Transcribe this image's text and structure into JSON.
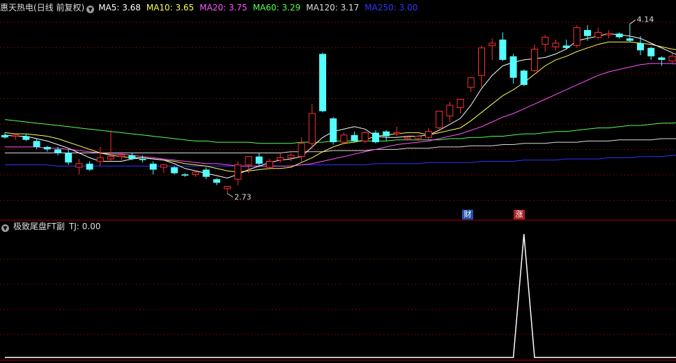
{
  "title": "惠天热电",
  "period": "(日线 前复权)",
  "ma_labels": [
    {
      "label": "MA5: 3.68",
      "color": "#ffffff"
    },
    {
      "label": "MA10: 3.65",
      "color": "#ffff55"
    },
    {
      "label": "MA20: 3.75",
      "color": "#ff55ff"
    },
    {
      "label": "MA60: 3.29",
      "color": "#55ff55"
    },
    {
      "label": "MA120: 3.17",
      "color": "#dddddd"
    },
    {
      "label": "MA250: 3.00",
      "color": "#3333ff"
    }
  ],
  "indicator": {
    "name": "极致尾盘FT副",
    "value_label": "TJ: 0.00"
  },
  "annotations": {
    "high": "4.14",
    "low": "2.73"
  },
  "badges": [
    {
      "text": "财",
      "color": "#2255aa"
    },
    {
      "text": "涨",
      "color": "#aa2222"
    }
  ],
  "colors": {
    "up": "#ff3030",
    "down": "#54ffff",
    "grid": "#7a0000",
    "divider": "#b00000"
  },
  "chart_data": {
    "type": "candlestick",
    "price_range": [
      2.6,
      4.2
    ],
    "candles": [
      {
        "o": 3.22,
        "h": 3.24,
        "l": 3.19,
        "c": 3.2
      },
      {
        "o": 3.21,
        "h": 3.23,
        "l": 3.18,
        "c": 3.22
      },
      {
        "o": 3.21,
        "h": 3.23,
        "l": 3.17,
        "c": 3.18
      },
      {
        "o": 3.17,
        "h": 3.19,
        "l": 3.1,
        "c": 3.12
      },
      {
        "o": 3.12,
        "h": 3.13,
        "l": 3.08,
        "c": 3.1
      },
      {
        "o": 3.1,
        "h": 3.12,
        "l": 3.05,
        "c": 3.07
      },
      {
        "o": 3.07,
        "h": 3.1,
        "l": 2.97,
        "c": 2.99
      },
      {
        "o": 2.95,
        "h": 3.02,
        "l": 2.89,
        "c": 2.98
      },
      {
        "o": 2.98,
        "h": 3.0,
        "l": 2.92,
        "c": 2.93
      },
      {
        "o": 3.0,
        "h": 3.12,
        "l": 2.96,
        "c": 3.03
      },
      {
        "o": 3.02,
        "h": 3.26,
        "l": 3.0,
        "c": 3.04
      },
      {
        "o": 3.04,
        "h": 3.08,
        "l": 3.01,
        "c": 3.05
      },
      {
        "o": 3.05,
        "h": 3.07,
        "l": 3.01,
        "c": 3.02
      },
      {
        "o": 3.02,
        "h": 3.05,
        "l": 2.99,
        "c": 3.01
      },
      {
        "o": 2.98,
        "h": 3.0,
        "l": 2.89,
        "c": 2.93
      },
      {
        "o": 2.95,
        "h": 2.98,
        "l": 2.9,
        "c": 2.97
      },
      {
        "o": 2.95,
        "h": 2.96,
        "l": 2.89,
        "c": 2.9
      },
      {
        "o": 2.89,
        "h": 2.9,
        "l": 2.87,
        "c": 2.88
      },
      {
        "o": 2.89,
        "h": 2.92,
        "l": 2.87,
        "c": 2.91
      },
      {
        "o": 2.93,
        "h": 2.95,
        "l": 2.85,
        "c": 2.87
      },
      {
        "o": 2.85,
        "h": 2.86,
        "l": 2.8,
        "c": 2.82
      },
      {
        "o": 2.77,
        "h": 2.79,
        "l": 2.73,
        "c": 2.79
      },
      {
        "o": 2.85,
        "h": 3.0,
        "l": 2.8,
        "c": 2.97
      },
      {
        "o": 2.97,
        "h": 3.0,
        "l": 2.9,
        "c": 3.04
      },
      {
        "o": 3.04,
        "h": 3.07,
        "l": 2.95,
        "c": 2.98
      },
      {
        "o": 2.95,
        "h": 3.02,
        "l": 2.93,
        "c": 3.0
      },
      {
        "o": 3.01,
        "h": 3.07,
        "l": 2.99,
        "c": 3.03
      },
      {
        "o": 3.03,
        "h": 3.07,
        "l": 3.0,
        "c": 3.05
      },
      {
        "o": 3.04,
        "h": 3.2,
        "l": 3.0,
        "c": 3.15
      },
      {
        "o": 3.15,
        "h": 3.48,
        "l": 3.1,
        "c": 3.4
      },
      {
        "o": 3.9,
        "h": 3.91,
        "l": 3.41,
        "c": 3.42
      },
      {
        "o": 3.36,
        "h": 3.37,
        "l": 3.14,
        "c": 3.16
      },
      {
        "o": 3.16,
        "h": 3.24,
        "l": 3.14,
        "c": 3.22
      },
      {
        "o": 3.22,
        "h": 3.25,
        "l": 3.16,
        "c": 3.17
      },
      {
        "o": 3.17,
        "h": 3.25,
        "l": 3.15,
        "c": 3.24
      },
      {
        "o": 3.24,
        "h": 3.26,
        "l": 3.15,
        "c": 3.16
      },
      {
        "o": 3.25,
        "h": 3.26,
        "l": 3.17,
        "c": 3.21
      },
      {
        "o": 3.23,
        "h": 3.29,
        "l": 3.21,
        "c": 3.24
      },
      {
        "o": 3.19,
        "h": 3.21,
        "l": 3.18,
        "c": 3.2
      },
      {
        "o": 3.19,
        "h": 3.22,
        "l": 3.17,
        "c": 3.21
      },
      {
        "o": 3.2,
        "h": 3.28,
        "l": 3.18,
        "c": 3.25
      },
      {
        "o": 3.28,
        "h": 3.42,
        "l": 3.26,
        "c": 3.42
      },
      {
        "o": 3.38,
        "h": 3.5,
        "l": 3.33,
        "c": 3.47
      },
      {
        "o": 3.45,
        "h": 3.52,
        "l": 3.4,
        "c": 3.52
      },
      {
        "o": 3.62,
        "h": 3.7,
        "l": 3.58,
        "c": 3.7
      },
      {
        "o": 3.72,
        "h": 3.97,
        "l": 3.62,
        "c": 3.95
      },
      {
        "o": 3.97,
        "h": 4.03,
        "l": 3.85,
        "c": 3.99
      },
      {
        "o": 4.02,
        "h": 4.08,
        "l": 3.84,
        "c": 3.85
      },
      {
        "o": 3.88,
        "h": 3.9,
        "l": 3.65,
        "c": 3.7
      },
      {
        "o": 3.76,
        "h": 3.77,
        "l": 3.63,
        "c": 3.64
      },
      {
        "o": 3.76,
        "h": 3.98,
        "l": 3.75,
        "c": 3.94
      },
      {
        "o": 3.98,
        "h": 4.06,
        "l": 3.92,
        "c": 4.04
      },
      {
        "o": 3.96,
        "h": 4.02,
        "l": 3.93,
        "c": 3.99
      },
      {
        "o": 3.97,
        "h": 4.02,
        "l": 3.94,
        "c": 3.95
      },
      {
        "o": 3.97,
        "h": 4.14,
        "l": 3.95,
        "c": 4.12
      },
      {
        "o": 4.1,
        "h": 4.14,
        "l": 4.01,
        "c": 4.05
      },
      {
        "o": 4.04,
        "h": 4.12,
        "l": 4.02,
        "c": 4.08
      },
      {
        "o": 4.06,
        "h": 4.1,
        "l": 4.03,
        "c": 4.07
      },
      {
        "o": 4.07,
        "h": 4.08,
        "l": 4.03,
        "c": 4.04
      },
      {
        "o": 4.03,
        "h": 4.15,
        "l": 4.0,
        "c": 4.01
      },
      {
        "o": 3.99,
        "h": 4.05,
        "l": 3.89,
        "c": 3.93
      },
      {
        "o": 3.95,
        "h": 3.96,
        "l": 3.85,
        "c": 3.88
      },
      {
        "o": 3.87,
        "h": 3.88,
        "l": 3.8,
        "c": 3.85
      },
      {
        "o": 3.84,
        "h": 3.91,
        "l": 3.81,
        "c": 3.88
      },
      {
        "o": 3.87,
        "h": 3.88,
        "l": 3.78,
        "c": 3.8
      },
      {
        "o": 3.83,
        "h": 3.95,
        "l": 3.79,
        "c": 3.91
      }
    ],
    "ma5": [
      3.22,
      3.21,
      3.21,
      3.19,
      3.17,
      3.14,
      3.11,
      3.07,
      3.03,
      3.0,
      3.0,
      3.0,
      3.02,
      3.03,
      3.02,
      3.01,
      2.98,
      2.94,
      2.92,
      2.9,
      2.88,
      2.86,
      2.89,
      2.93,
      2.96,
      2.99,
      3.01,
      3.02,
      3.04,
      3.12,
      3.2,
      3.25,
      3.27,
      3.29,
      3.27,
      3.21,
      3.2,
      3.2,
      3.21,
      3.21,
      3.22,
      3.26,
      3.31,
      3.36,
      3.47,
      3.61,
      3.72,
      3.8,
      3.83,
      3.85,
      3.86,
      3.87,
      3.9,
      3.94,
      4.01,
      4.03,
      4.05,
      4.07,
      4.06,
      4.05,
      4.03,
      3.99,
      3.95,
      3.91,
      3.87,
      3.86
    ],
    "ma10": [
      3.24,
      3.23,
      3.23,
      3.22,
      3.21,
      3.19,
      3.16,
      3.13,
      3.1,
      3.07,
      3.05,
      3.04,
      3.03,
      3.03,
      3.02,
      3.01,
      3.0,
      2.98,
      2.97,
      2.96,
      2.94,
      2.92,
      2.91,
      2.92,
      2.93,
      2.94,
      2.94,
      2.95,
      2.99,
      3.03,
      3.08,
      3.12,
      3.15,
      3.16,
      3.18,
      3.21,
      3.22,
      3.23,
      3.24,
      3.24,
      3.22,
      3.24,
      3.26,
      3.28,
      3.34,
      3.41,
      3.48,
      3.55,
      3.6,
      3.66,
      3.73,
      3.8,
      3.85,
      3.88,
      3.92,
      3.95,
      3.98,
      4.0,
      4.0,
      4.0,
      3.99,
      3.98,
      3.96,
      3.94,
      3.93,
      3.91
    ],
    "ma20": [
      3.12,
      3.12,
      3.12,
      3.12,
      3.11,
      3.11,
      3.1,
      3.09,
      3.08,
      3.07,
      3.06,
      3.06,
      3.05,
      3.04,
      3.03,
      3.02,
      3.01,
      3.0,
      2.99,
      2.98,
      2.98,
      2.97,
      2.96,
      2.96,
      2.96,
      2.96,
      2.96,
      2.96,
      2.97,
      2.98,
      3.0,
      3.02,
      3.04,
      3.06,
      3.08,
      3.1,
      3.12,
      3.14,
      3.15,
      3.16,
      3.17,
      3.19,
      3.21,
      3.23,
      3.26,
      3.29,
      3.33,
      3.37,
      3.4,
      3.44,
      3.48,
      3.52,
      3.56,
      3.6,
      3.64,
      3.68,
      3.72,
      3.75,
      3.77,
      3.79,
      3.81,
      3.82,
      3.82,
      3.82,
      3.81,
      3.8
    ],
    "ma60": [
      3.35,
      3.34,
      3.33,
      3.32,
      3.31,
      3.3,
      3.29,
      3.28,
      3.27,
      3.26,
      3.25,
      3.24,
      3.23,
      3.22,
      3.21,
      3.2,
      3.19,
      3.18,
      3.17,
      3.17,
      3.16,
      3.16,
      3.16,
      3.16,
      3.15,
      3.15,
      3.15,
      3.15,
      3.16,
      3.16,
      3.16,
      3.17,
      3.17,
      3.17,
      3.17,
      3.17,
      3.17,
      3.18,
      3.18,
      3.18,
      3.18,
      3.18,
      3.19,
      3.19,
      3.2,
      3.2,
      3.21,
      3.21,
      3.22,
      3.23,
      3.23,
      3.24,
      3.25,
      3.25,
      3.26,
      3.27,
      3.28,
      3.28,
      3.29,
      3.3,
      3.3,
      3.31,
      3.32,
      3.32,
      3.33,
      3.34
    ],
    "ma120": [
      3.07,
      3.07,
      3.07,
      3.07,
      3.07,
      3.07,
      3.07,
      3.07,
      3.07,
      3.07,
      3.07,
      3.07,
      3.07,
      3.07,
      3.07,
      3.07,
      3.07,
      3.07,
      3.07,
      3.07,
      3.07,
      3.07,
      3.07,
      3.07,
      3.07,
      3.07,
      3.07,
      3.08,
      3.08,
      3.08,
      3.08,
      3.09,
      3.09,
      3.09,
      3.09,
      3.1,
      3.1,
      3.1,
      3.11,
      3.11,
      3.11,
      3.12,
      3.12,
      3.12,
      3.13,
      3.13,
      3.13,
      3.14,
      3.14,
      3.15,
      3.15,
      3.15,
      3.16,
      3.16,
      3.16,
      3.17,
      3.17,
      3.17,
      3.18,
      3.18,
      3.18,
      3.18,
      3.19,
      3.19,
      3.19,
      3.19
    ],
    "ma250": [
      2.97,
      2.97,
      2.97,
      2.97,
      2.97,
      2.96,
      2.96,
      2.96,
      2.96,
      2.96,
      2.96,
      2.96,
      2.96,
      2.96,
      2.96,
      2.96,
      2.96,
      2.96,
      2.96,
      2.96,
      2.96,
      2.96,
      2.96,
      2.96,
      2.96,
      2.96,
      2.96,
      2.96,
      2.97,
      2.97,
      2.97,
      2.97,
      2.97,
      2.97,
      2.97,
      2.98,
      2.98,
      2.98,
      2.98,
      2.98,
      2.99,
      2.99,
      2.99,
      2.99,
      2.99,
      3.0,
      3.0,
      3.0,
      3.0,
      3.01,
      3.01,
      3.01,
      3.01,
      3.02,
      3.02,
      3.02,
      3.02,
      3.03,
      3.03,
      3.03,
      3.04,
      3.04,
      3.04,
      3.05,
      3.05,
      3.05
    ],
    "tj": [
      0,
      0,
      0,
      0,
      0,
      0,
      0,
      0,
      0,
      0,
      0,
      0,
      0,
      0,
      0,
      0,
      0,
      0,
      0,
      0,
      0,
      0,
      0,
      0,
      0,
      0,
      0,
      0,
      0,
      0,
      0,
      0,
      0,
      0,
      0,
      0,
      0,
      0,
      0,
      0,
      0,
      0,
      0,
      0,
      0,
      0,
      0,
      0,
      0,
      1,
      0,
      0,
      0,
      0,
      0,
      0,
      0,
      0,
      0,
      0,
      0,
      0,
      0,
      0,
      0,
      0
    ],
    "tj_range": [
      0,
      1
    ]
  }
}
